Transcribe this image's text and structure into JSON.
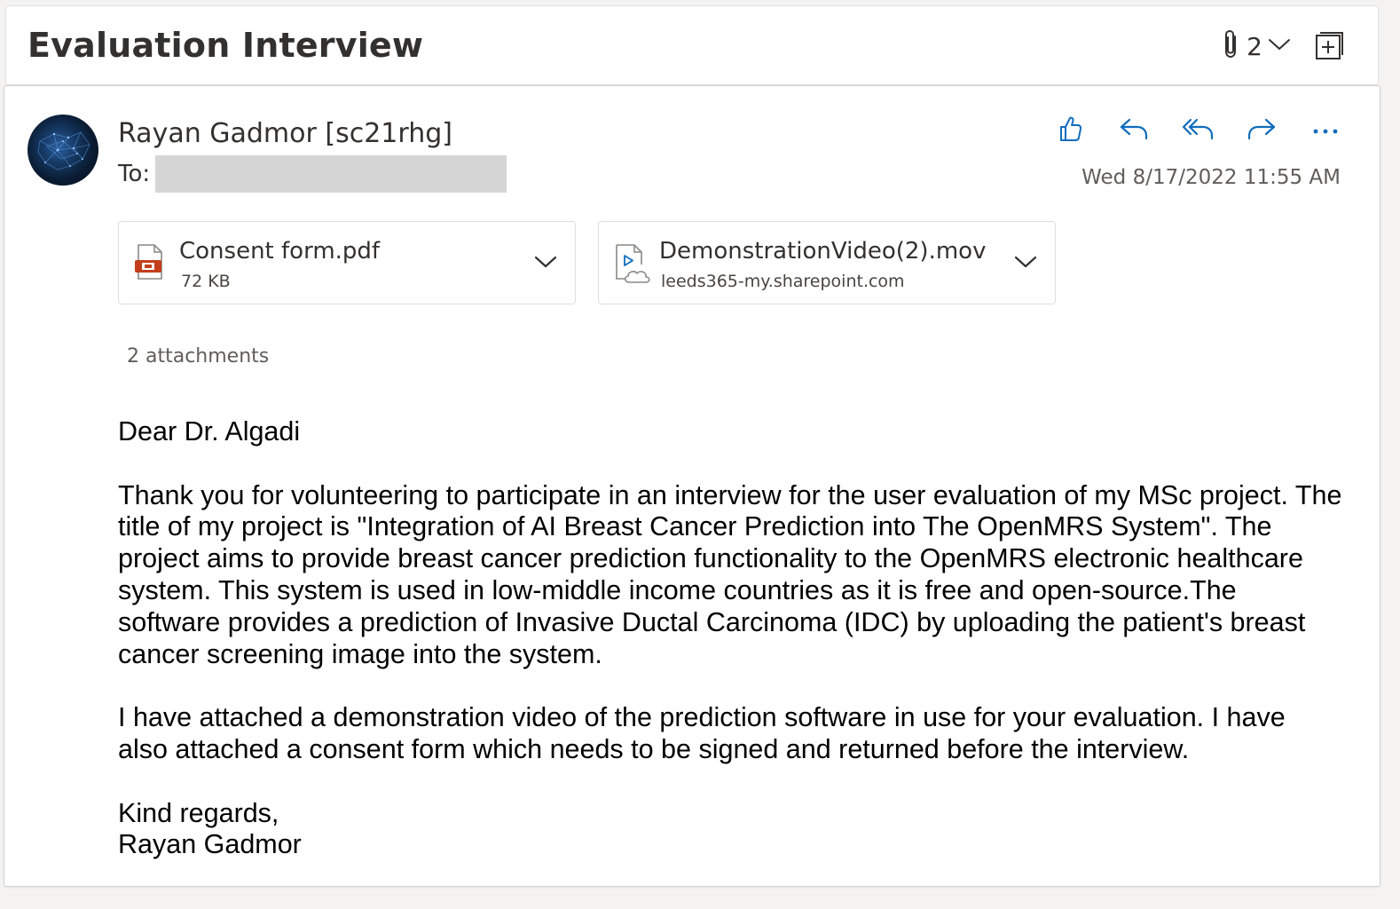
{
  "header": {
    "subject": "Evaluation Interview",
    "attachment_count": "2",
    "icons": {
      "attachment": "paperclip-icon",
      "dropdown": "chevron-down-icon",
      "expand": "open-in-new-window-icon"
    }
  },
  "message": {
    "sender": "Rayan Gadmor [sc21rhg]",
    "to_label": "To:",
    "datetime": "Wed 8/17/2022 11:55 AM",
    "actions": [
      "like-icon",
      "reply-icon",
      "reply-all-icon",
      "forward-icon",
      "more-icon"
    ],
    "attachments": [
      {
        "name": "Consent form.pdf",
        "meta": "72 KB",
        "icon": "pdf-file-icon"
      },
      {
        "name": "DemonstrationVideo(2).mov",
        "meta": "leeds365-my.sharepoint.com",
        "icon": "cloud-video-file-icon"
      }
    ],
    "attachments_summary": "2 attachments",
    "body": {
      "greeting": "Dear Dr. Algadi",
      "paragraph1": "Thank you for volunteering to participate in an interview for the user evaluation of my MSc project. The title of my project is \"Integration of AI Breast Cancer Prediction into The OpenMRS System\". The project aims to provide breast cancer prediction functionality to the OpenMRS electronic healthcare system. This system is used in low-middle income countries as it is free and open-source.The software provides a prediction of Invasive Ductal Carcinoma (IDC) by uploading the patient's breast cancer screening image into the system.",
      "paragraph2": "I have attached a demonstration video of the prediction software in use for your evaluation. I have also attached a consent form which needs to be signed and returned before the interview.",
      "closing": "Kind regards,",
      "signature": "Rayan Gadmor"
    }
  },
  "colors": {
    "accent": "#0f6cbd",
    "pdf_red": "#c43e1c",
    "text": "#323130",
    "muted": "#605e5c"
  }
}
